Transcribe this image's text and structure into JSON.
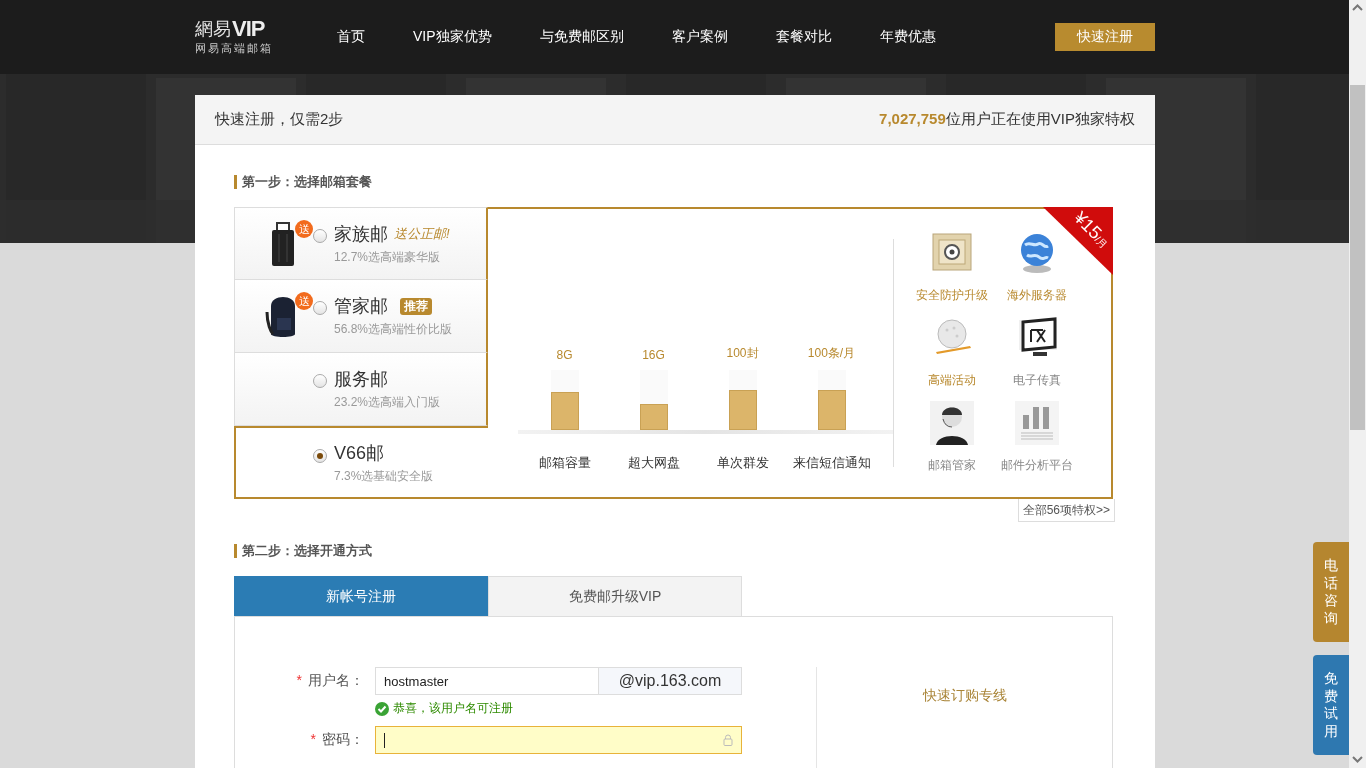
{
  "header": {
    "logo": {
      "brand": "網易",
      "mark": "VIP",
      "subtitle": "网易高端邮箱"
    },
    "nav": [
      "首页",
      "VIP独家优势",
      "与免费邮区别",
      "客户案例",
      "套餐对比",
      "年费优惠"
    ],
    "register_button": "快速注册"
  },
  "card": {
    "title": "快速注册，仅需2步",
    "user_count": "7,027,759",
    "user_count_suffix": "位用户正在使用VIP独家特权"
  },
  "step1": {
    "title": "第一步：选择邮箱套餐",
    "plans": [
      {
        "name": "家族邮",
        "gift_badge": "送",
        "tag": {
          "kind": "note",
          "text": "送公正邮!"
        },
        "share": "12.7%选高端豪华版",
        "selected": false
      },
      {
        "name": "管家邮",
        "gift_badge": "送",
        "tag": {
          "kind": "badge",
          "text": "推荐"
        },
        "share": "56.8%选高端性价比版",
        "selected": false
      },
      {
        "name": "服务邮",
        "share": "23.2%选高端入门版",
        "selected": false
      },
      {
        "name": "V66邮",
        "share": "7.3%选基础安全版",
        "selected": true
      }
    ],
    "bars": [
      {
        "value": "8G",
        "level": 0.63,
        "caption": "邮箱容量"
      },
      {
        "value": "16G",
        "level": 0.43,
        "caption": "超大网盘"
      },
      {
        "value": "100封",
        "level": 0.66,
        "caption": "单次群发"
      },
      {
        "value": "100条/月",
        "level": 0.66,
        "caption": "来信短信通知"
      }
    ],
    "perks": [
      {
        "label": "安全防护升级",
        "highlight": true
      },
      {
        "label": "海外服务器",
        "highlight": true
      },
      {
        "label": "高端活动",
        "highlight": true
      },
      {
        "label": "电子传真",
        "highlight": false
      },
      {
        "label": "邮箱管家",
        "highlight": false
      },
      {
        "label": "邮件分析平台",
        "highlight": false
      }
    ],
    "price": {
      "amount": "¥15",
      "unit": "/月"
    },
    "all_perks_button": "全部56项特权>>"
  },
  "step2": {
    "title": "第二步：选择开通方式",
    "tabs": [
      {
        "label": "新帐号注册",
        "selected": true
      },
      {
        "label": "免费邮升级VIP",
        "selected": false
      }
    ],
    "username": {
      "required_mark": "*",
      "label": "用户名：",
      "value": "hostmaster",
      "domain": "@vip.163.com",
      "message": "恭喜，该用户名可注册",
      "focused": false
    },
    "password": {
      "required_mark": "*",
      "label": "密码：",
      "focused": true
    },
    "hotline_title": "快速订购专线"
  },
  "side_buttons": [
    {
      "label": "电话咨询",
      "color": "#b5862f"
    },
    {
      "label": "免费试用",
      "color": "#2e78b0"
    }
  ]
}
